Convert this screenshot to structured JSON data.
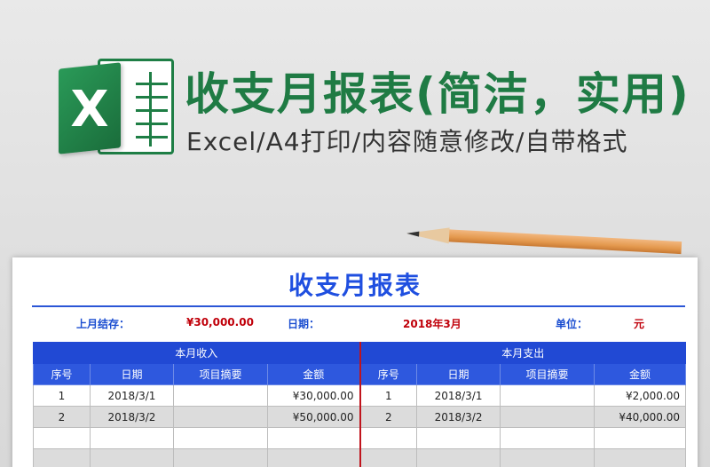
{
  "banner": {
    "title": "收支月报表(简洁，实用)",
    "subtitle": "Excel/A4打印/内容随意修改/自带格式",
    "logo_letter": "X",
    "logo_icon": "excel-icon"
  },
  "sheet": {
    "title": "收支月报表",
    "info": {
      "last_month_label": "上月结存：",
      "last_month_value": "¥30,000.00",
      "date_label": "日期：",
      "date_value": "2018年3月",
      "unit_label": "单位：",
      "unit_value": "元"
    },
    "income": {
      "section_label": "本月收入",
      "headers": [
        "序号",
        "日期",
        "项目摘要",
        "金额"
      ],
      "rows": [
        [
          "1",
          "2018/3/1",
          "",
          "¥30,000.00"
        ],
        [
          "2",
          "2018/3/2",
          "",
          "¥50,000.00"
        ],
        [
          "",
          "",
          "",
          ""
        ],
        [
          "",
          "",
          "",
          ""
        ]
      ]
    },
    "expense": {
      "section_label": "本月支出",
      "headers": [
        "序号",
        "日期",
        "项目摘要",
        "金额"
      ],
      "rows": [
        [
          "1",
          "2018/3/1",
          "",
          "¥2,000.00"
        ],
        [
          "2",
          "2018/3/2",
          "",
          "¥40,000.00"
        ],
        [
          "",
          "",
          "",
          ""
        ],
        [
          "",
          "",
          "",
          ""
        ]
      ]
    }
  },
  "colors": {
    "banner_green": "#1f7b44",
    "title_blue": "#1f4fe0",
    "header_blue": "#2149d4",
    "value_red": "#c0000a"
  }
}
